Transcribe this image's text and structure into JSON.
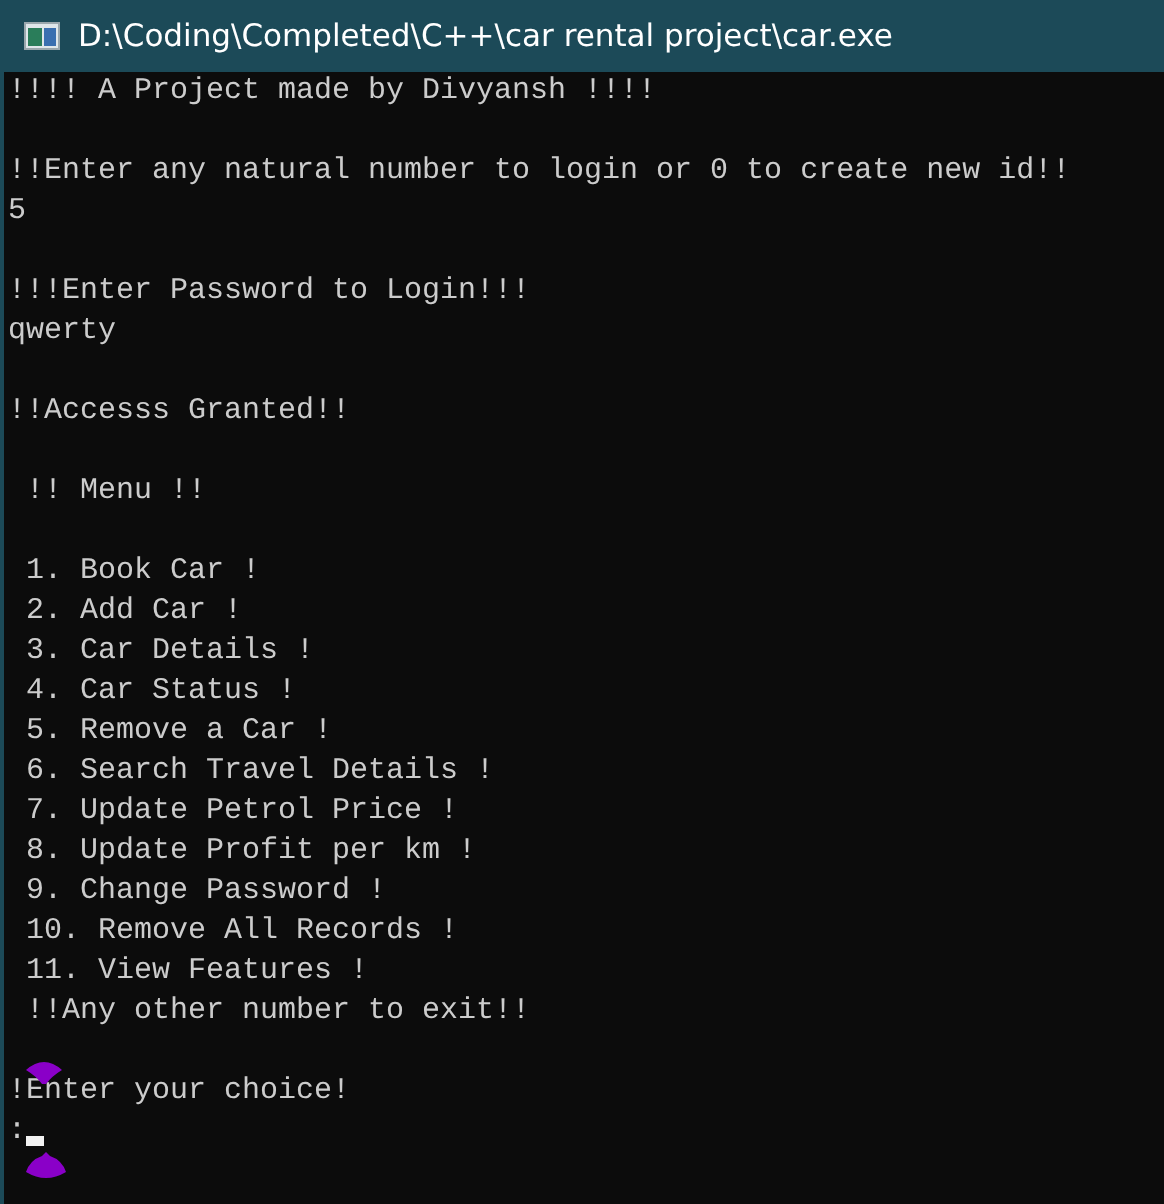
{
  "window": {
    "title": "D:\\Coding\\Completed\\C++\\car rental project\\car.exe"
  },
  "console": {
    "blocks": [
      [
        "!!!! A Project made by Divyansh !!!!"
      ],
      [
        "!!Enter any natural number to login or 0 to create new id!!",
        "5"
      ],
      [
        "!!!Enter Password to Login!!!",
        "qwerty"
      ],
      [
        "!!Accesss Granted!!"
      ],
      [
        " !! Menu !!"
      ],
      [
        " 1. Book Car !",
        " 2. Add Car !",
        " 3. Car Details !",
        " 4. Car Status !",
        " 5. Remove a Car !",
        " 6. Search Travel Details !",
        " 7. Update Petrol Price !",
        " 8. Update Profit per km !",
        " 9. Change Password !",
        " 10. Remove All Records !",
        " 11. View Features !",
        " !!Any other number to exit!!"
      ],
      [
        "!Enter your choice!",
        ":"
      ]
    ]
  }
}
